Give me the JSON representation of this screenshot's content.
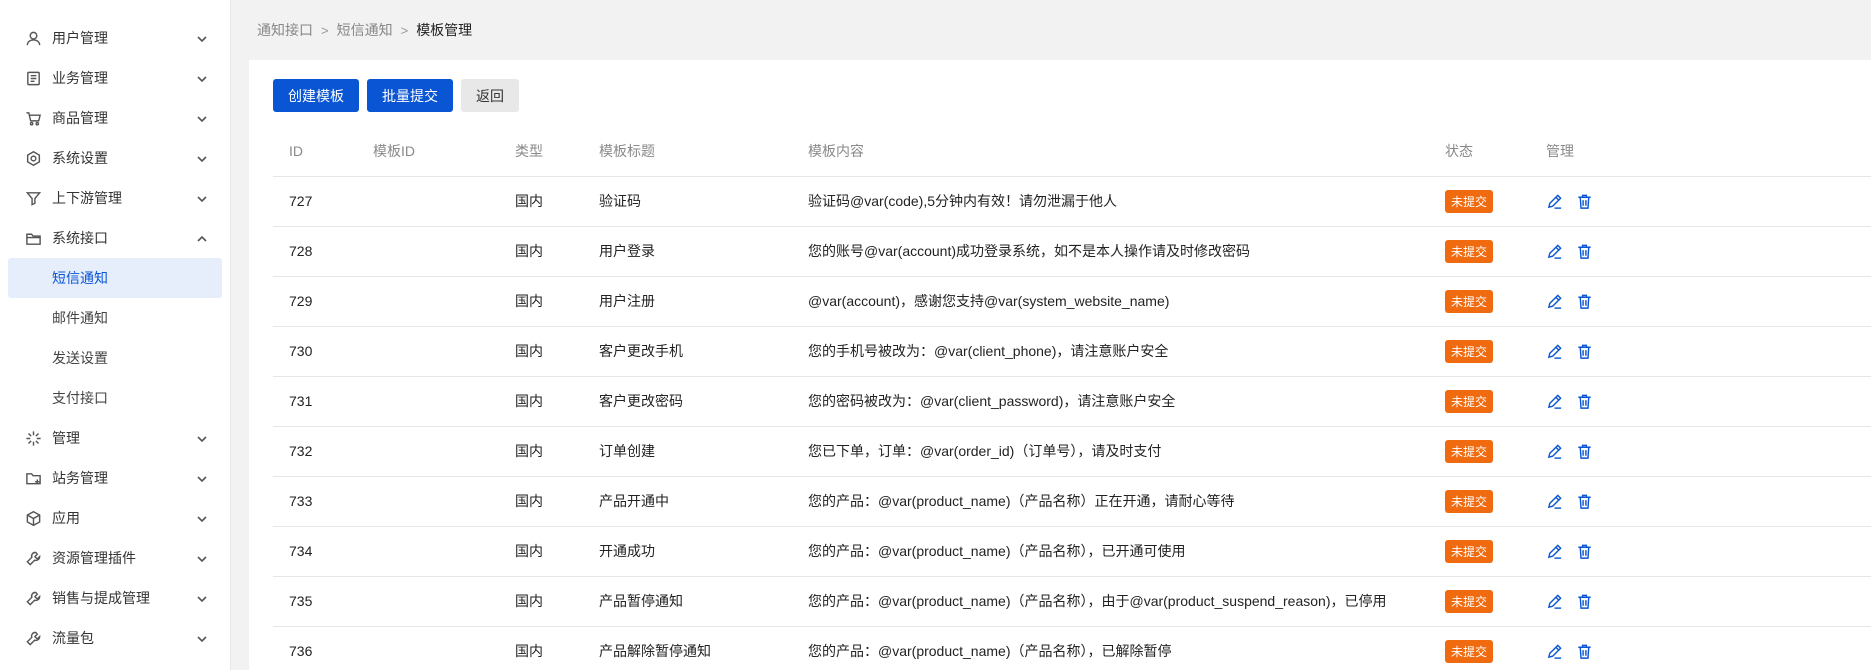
{
  "sidebar": {
    "items": [
      {
        "label": "用户管理",
        "icon": "user-icon",
        "expanded": false
      },
      {
        "label": "业务管理",
        "icon": "document-icon",
        "expanded": false
      },
      {
        "label": "商品管理",
        "icon": "cart-icon",
        "expanded": false
      },
      {
        "label": "系统设置",
        "icon": "hexagon-settings-icon",
        "expanded": false
      },
      {
        "label": "上下游管理",
        "icon": "funnel-icon",
        "expanded": false
      },
      {
        "label": "系统接口",
        "icon": "folder-icon",
        "expanded": true
      },
      {
        "label": "管理",
        "icon": "burst-icon",
        "expanded": false
      },
      {
        "label": "站务管理",
        "icon": "folder-add-icon",
        "expanded": false
      },
      {
        "label": "应用",
        "icon": "box-icon",
        "expanded": false
      },
      {
        "label": "资源管理插件",
        "icon": "wrench-icon",
        "expanded": false
      },
      {
        "label": "销售与提成管理",
        "icon": "wrench-icon",
        "expanded": false
      },
      {
        "label": "流量包",
        "icon": "wrench-icon",
        "expanded": false
      }
    ],
    "subitems": [
      "短信通知",
      "邮件通知",
      "发送设置",
      "支付接口"
    ],
    "active_sub": "短信通知"
  },
  "breadcrumb": [
    "通知接口",
    "短信通知",
    "模板管理"
  ],
  "toolbar": {
    "create_label": "创建模板",
    "batch_label": "批量提交",
    "back_label": "返回"
  },
  "table": {
    "headers": {
      "id": "ID",
      "template_id": "模板ID",
      "type": "类型",
      "title": "模板标题",
      "content": "模板内容",
      "status": "状态",
      "manage": "管理"
    },
    "rows": [
      {
        "id": "727",
        "template_id": "",
        "type": "国内",
        "title": "验证码",
        "content": "验证码@var(code),5分钟内有效！请勿泄漏于他人",
        "status": "未提交"
      },
      {
        "id": "728",
        "template_id": "",
        "type": "国内",
        "title": "用户登录",
        "content": "您的账号@var(account)成功登录系统，如不是本人操作请及时修改密码",
        "status": "未提交"
      },
      {
        "id": "729",
        "template_id": "",
        "type": "国内",
        "title": "用户注册",
        "content": "@var(account)，感谢您支持@var(system_website_name)",
        "status": "未提交"
      },
      {
        "id": "730",
        "template_id": "",
        "type": "国内",
        "title": "客户更改手机",
        "content": "您的手机号被改为：@var(client_phone)，请注意账户安全",
        "status": "未提交"
      },
      {
        "id": "731",
        "template_id": "",
        "type": "国内",
        "title": "客户更改密码",
        "content": "您的密码被改为：@var(client_password)，请注意账户安全",
        "status": "未提交"
      },
      {
        "id": "732",
        "template_id": "",
        "type": "国内",
        "title": "订单创建",
        "content": "您已下单，订单：@var(order_id)（订单号），请及时支付",
        "status": "未提交"
      },
      {
        "id": "733",
        "template_id": "",
        "type": "国内",
        "title": "产品开通中",
        "content": "您的产品：@var(product_name)（产品名称）正在开通，请耐心等待",
        "status": "未提交"
      },
      {
        "id": "734",
        "template_id": "",
        "type": "国内",
        "title": "开通成功",
        "content": "您的产品：@var(product_name)（产品名称），已开通可使用",
        "status": "未提交"
      },
      {
        "id": "735",
        "template_id": "",
        "type": "国内",
        "title": "产品暂停通知",
        "content": "您的产品：@var(product_name)（产品名称），由于@var(product_suspend_reason)，已停用",
        "status": "未提交"
      },
      {
        "id": "736",
        "template_id": "",
        "type": "国内",
        "title": "产品解除暂停通知",
        "content": "您的产品：@var(product_name)（产品名称），已解除暂停",
        "status": "未提交"
      }
    ]
  },
  "colors": {
    "primary": "#0a55d3",
    "status_badge": "#f06a0f",
    "active_bg": "#e6eefc"
  }
}
